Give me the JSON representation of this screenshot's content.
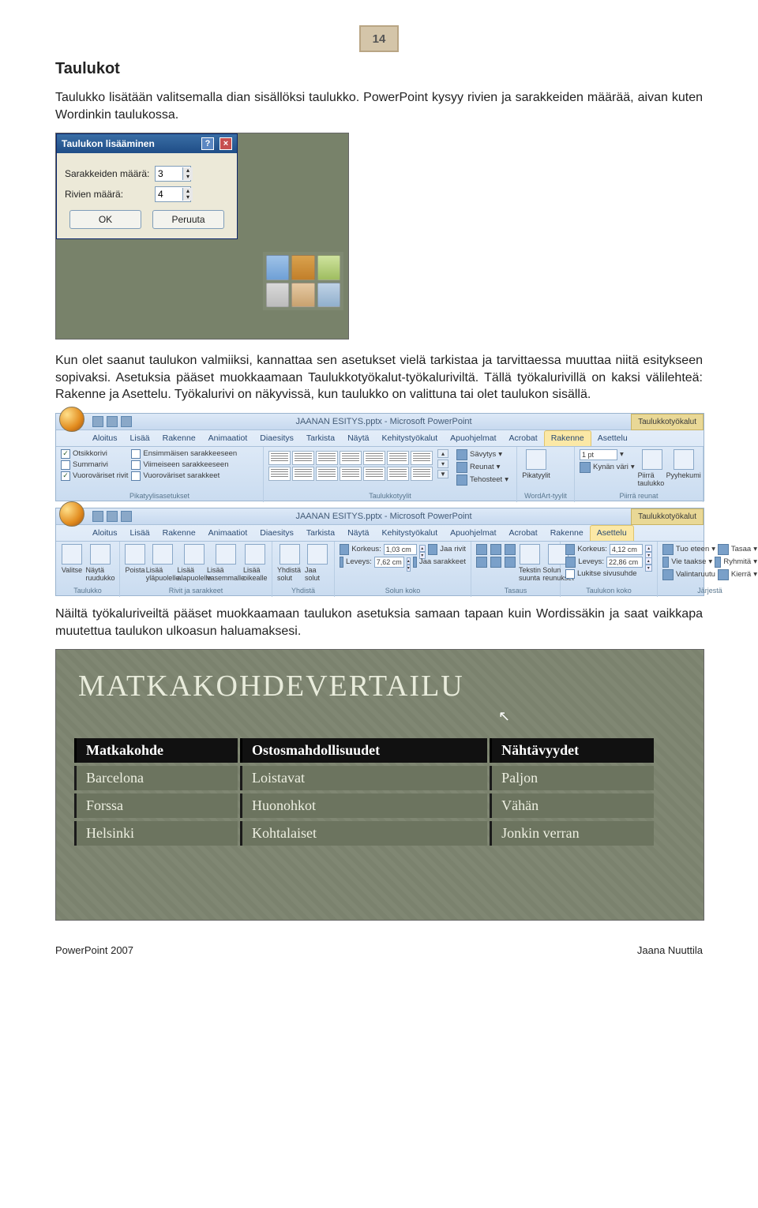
{
  "page_number": "14",
  "heading": "Taulukot",
  "para1": "Taulukko lisätään valitsemalla dian sisällöksi taulukko. PowerPoint kysyy rivien ja sarakkeiden määrää, aivan kuten Wordinkin taulukossa.",
  "dialog": {
    "title": "Taulukon lisääminen",
    "cols_label": "Sarakkeiden määrä:",
    "cols_value": "3",
    "rows_label": "Rivien määrä:",
    "rows_value": "4",
    "ok": "OK",
    "cancel": "Peruuta"
  },
  "para2": "Kun olet saanut taulukon valmiiksi, kannattaa sen asetukset vielä tarkistaa ja tarvittaessa muuttaa niitä esitykseen sopivaksi. Asetuksia pääset muokkaamaan Taulukkotyökalut-työkaluriviltä. Tällä työkalurivillä on kaksi välilehteä: Rakenne ja Asettelu. Työkalurivi on näkyvissä, kun taulukko on valittuna tai olet taulukon sisällä.",
  "ribbon_common": {
    "doc_title": "JAANAN ESITYS.pptx - Microsoft PowerPoint",
    "context_label": "Taulukkotyökalut",
    "tabs": [
      "Aloitus",
      "Lisää",
      "Rakenne",
      "Animaatiot",
      "Diaesitys",
      "Tarkista",
      "Näytä",
      "Kehitystyökalut",
      "Apuohjelmat",
      "Acrobat"
    ],
    "ctx_tabs": [
      "Rakenne",
      "Asettelu"
    ]
  },
  "ribbon1": {
    "active_ctx": "Rakenne",
    "checks": {
      "c1": "Otsikkorivi",
      "c1v": true,
      "c2": "Summarivi",
      "c2v": false,
      "c3": "Vuoroväriset rivit",
      "c3v": true,
      "c4": "Ensimmäisen sarakkeeseen",
      "c4v": false,
      "c5": "Viimeiseen sarakkeeseen",
      "c5v": false,
      "c6": "Vuoroväriset sarakkeet",
      "c6v": false,
      "group": "Pikatyylisasetukset"
    },
    "styles_group": "Taulukkotyylit",
    "shading": "Sävytys",
    "borders": "Reunat",
    "effects": "Tehosteet",
    "quick": "Pikatyylit",
    "wa_group": "WordArt-tyylit",
    "pen_w": "1 pt",
    "pen_c": "Kynän väri",
    "draw": "Piirrä taulukko",
    "eraser": "Pyyhekumi",
    "draw_group": "Piirrä reunat"
  },
  "ribbon2": {
    "active_ctx": "Asettelu",
    "select": "Valitse",
    "grid": "Näytä ruudukko",
    "delete": "Poista",
    "ins_above": "Lisää yläpuolelle",
    "ins_below": "Lisää alapuolelle",
    "ins_left": "Lisää vasemmalle",
    "ins_right": "Lisää oikealle",
    "g_table": "Taulukko",
    "g_rows": "Rivit ja sarakkeet",
    "merge": "Yhdistä solut",
    "split": "Jaa solut",
    "g_merge": "Yhdistä",
    "height_l": "Korkeus:",
    "height_v": "1,03 cm",
    "width_l": "Leveys:",
    "width_v": "7,62 cm",
    "dist_rows": "Jaa rivit",
    "dist_cols": "Jaa sarakkeet",
    "g_size": "Solun koko",
    "text_dir": "Tekstin suunta",
    "margins": "Solun reunukset",
    "g_align": "Tasaus",
    "th_l": "Korkeus:",
    "th_v": "4,12 cm",
    "tw_l": "Leveys:",
    "tw_v": "22,86 cm",
    "lock": "Lukitse sivusuhde",
    "g_tsz": "Taulukon koko",
    "fwd": "Tuo eteen",
    "back": "Vie taakse",
    "selpane": "Valintaruutu",
    "align": "Tasaa",
    "group": "Ryhmitä",
    "rotate": "Kierrä",
    "g_arr": "Järjestä"
  },
  "para3": "Näiltä työkaluriveiltä pääset muokkaamaan taulukon asetuksia samaan tapaan kuin Wordissäkin ja saat vaikkapa muutettua taulukon ulkoasun haluamaksesi.",
  "slide": {
    "title": "MATKAKOHDEVERTAILU",
    "headers": [
      "Matkakohde",
      "Ostosmahdollisuudet",
      "Nähtävyydet"
    ],
    "rows": [
      [
        "Barcelona",
        "Loistavat",
        "Paljon"
      ],
      [
        "Forssa",
        "Huonohkot",
        "Vähän"
      ],
      [
        "Helsinki",
        "Kohtalaiset",
        "Jonkin verran"
      ]
    ]
  },
  "footer": {
    "left": "PowerPoint 2007",
    "right": "Jaana Nuuttila"
  }
}
